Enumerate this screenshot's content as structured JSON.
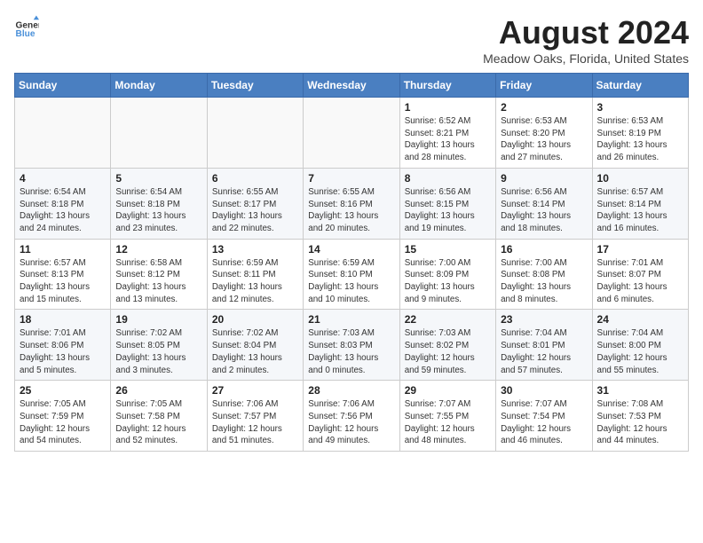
{
  "header": {
    "logo_line1": "General",
    "logo_line2": "Blue",
    "month_title": "August 2024",
    "location": "Meadow Oaks, Florida, United States"
  },
  "weekdays": [
    "Sunday",
    "Monday",
    "Tuesday",
    "Wednesday",
    "Thursday",
    "Friday",
    "Saturday"
  ],
  "weeks": [
    [
      {
        "day": "",
        "info": ""
      },
      {
        "day": "",
        "info": ""
      },
      {
        "day": "",
        "info": ""
      },
      {
        "day": "",
        "info": ""
      },
      {
        "day": "1",
        "info": "Sunrise: 6:52 AM\nSunset: 8:21 PM\nDaylight: 13 hours\nand 28 minutes."
      },
      {
        "day": "2",
        "info": "Sunrise: 6:53 AM\nSunset: 8:20 PM\nDaylight: 13 hours\nand 27 minutes."
      },
      {
        "day": "3",
        "info": "Sunrise: 6:53 AM\nSunset: 8:19 PM\nDaylight: 13 hours\nand 26 minutes."
      }
    ],
    [
      {
        "day": "4",
        "info": "Sunrise: 6:54 AM\nSunset: 8:18 PM\nDaylight: 13 hours\nand 24 minutes."
      },
      {
        "day": "5",
        "info": "Sunrise: 6:54 AM\nSunset: 8:18 PM\nDaylight: 13 hours\nand 23 minutes."
      },
      {
        "day": "6",
        "info": "Sunrise: 6:55 AM\nSunset: 8:17 PM\nDaylight: 13 hours\nand 22 minutes."
      },
      {
        "day": "7",
        "info": "Sunrise: 6:55 AM\nSunset: 8:16 PM\nDaylight: 13 hours\nand 20 minutes."
      },
      {
        "day": "8",
        "info": "Sunrise: 6:56 AM\nSunset: 8:15 PM\nDaylight: 13 hours\nand 19 minutes."
      },
      {
        "day": "9",
        "info": "Sunrise: 6:56 AM\nSunset: 8:14 PM\nDaylight: 13 hours\nand 18 minutes."
      },
      {
        "day": "10",
        "info": "Sunrise: 6:57 AM\nSunset: 8:14 PM\nDaylight: 13 hours\nand 16 minutes."
      }
    ],
    [
      {
        "day": "11",
        "info": "Sunrise: 6:57 AM\nSunset: 8:13 PM\nDaylight: 13 hours\nand 15 minutes."
      },
      {
        "day": "12",
        "info": "Sunrise: 6:58 AM\nSunset: 8:12 PM\nDaylight: 13 hours\nand 13 minutes."
      },
      {
        "day": "13",
        "info": "Sunrise: 6:59 AM\nSunset: 8:11 PM\nDaylight: 13 hours\nand 12 minutes."
      },
      {
        "day": "14",
        "info": "Sunrise: 6:59 AM\nSunset: 8:10 PM\nDaylight: 13 hours\nand 10 minutes."
      },
      {
        "day": "15",
        "info": "Sunrise: 7:00 AM\nSunset: 8:09 PM\nDaylight: 13 hours\nand 9 minutes."
      },
      {
        "day": "16",
        "info": "Sunrise: 7:00 AM\nSunset: 8:08 PM\nDaylight: 13 hours\nand 8 minutes."
      },
      {
        "day": "17",
        "info": "Sunrise: 7:01 AM\nSunset: 8:07 PM\nDaylight: 13 hours\nand 6 minutes."
      }
    ],
    [
      {
        "day": "18",
        "info": "Sunrise: 7:01 AM\nSunset: 8:06 PM\nDaylight: 13 hours\nand 5 minutes."
      },
      {
        "day": "19",
        "info": "Sunrise: 7:02 AM\nSunset: 8:05 PM\nDaylight: 13 hours\nand 3 minutes."
      },
      {
        "day": "20",
        "info": "Sunrise: 7:02 AM\nSunset: 8:04 PM\nDaylight: 13 hours\nand 2 minutes."
      },
      {
        "day": "21",
        "info": "Sunrise: 7:03 AM\nSunset: 8:03 PM\nDaylight: 13 hours\nand 0 minutes."
      },
      {
        "day": "22",
        "info": "Sunrise: 7:03 AM\nSunset: 8:02 PM\nDaylight: 12 hours\nand 59 minutes."
      },
      {
        "day": "23",
        "info": "Sunrise: 7:04 AM\nSunset: 8:01 PM\nDaylight: 12 hours\nand 57 minutes."
      },
      {
        "day": "24",
        "info": "Sunrise: 7:04 AM\nSunset: 8:00 PM\nDaylight: 12 hours\nand 55 minutes."
      }
    ],
    [
      {
        "day": "25",
        "info": "Sunrise: 7:05 AM\nSunset: 7:59 PM\nDaylight: 12 hours\nand 54 minutes."
      },
      {
        "day": "26",
        "info": "Sunrise: 7:05 AM\nSunset: 7:58 PM\nDaylight: 12 hours\nand 52 minutes."
      },
      {
        "day": "27",
        "info": "Sunrise: 7:06 AM\nSunset: 7:57 PM\nDaylight: 12 hours\nand 51 minutes."
      },
      {
        "day": "28",
        "info": "Sunrise: 7:06 AM\nSunset: 7:56 PM\nDaylight: 12 hours\nand 49 minutes."
      },
      {
        "day": "29",
        "info": "Sunrise: 7:07 AM\nSunset: 7:55 PM\nDaylight: 12 hours\nand 48 minutes."
      },
      {
        "day": "30",
        "info": "Sunrise: 7:07 AM\nSunset: 7:54 PM\nDaylight: 12 hours\nand 46 minutes."
      },
      {
        "day": "31",
        "info": "Sunrise: 7:08 AM\nSunset: 7:53 PM\nDaylight: 12 hours\nand 44 minutes."
      }
    ]
  ]
}
